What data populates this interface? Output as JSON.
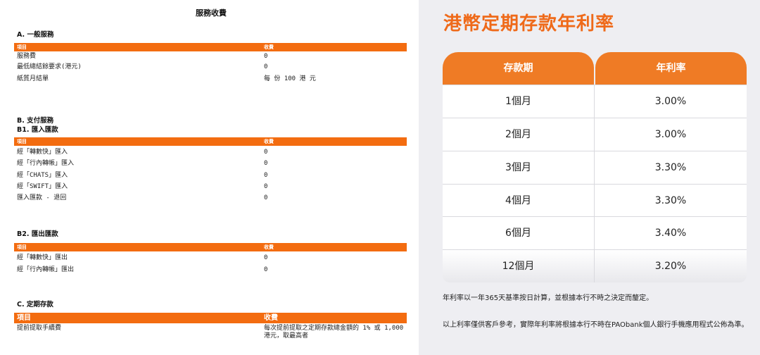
{
  "fees": {
    "title": "服務收費",
    "col_item": "項目",
    "col_fee": "收費",
    "sectionA": {
      "heading": "A. 一般服務",
      "rows": [
        {
          "item": "服務費",
          "fee": "0"
        },
        {
          "item": "最低總結餘要求(港元)",
          "fee": "0"
        },
        {
          "item": "紙質月結單",
          "fee": "每 份 100 港 元"
        }
      ]
    },
    "sectionB": {
      "heading": "B. 支付服務",
      "b1_heading": "B1. 匯入匯款",
      "b1_rows": [
        {
          "item": "經「轉數快」匯入",
          "fee": "0"
        },
        {
          "item": "經「行內轉帳」匯入",
          "fee": "0"
        },
        {
          "item": "經「CHATS」匯入",
          "fee": "0"
        },
        {
          "item": "經「SWIFT」匯入",
          "fee": "0"
        },
        {
          "item": "匯入匯款 - 退回",
          "fee": "0"
        }
      ],
      "b2_heading": "B2. 匯出匯款",
      "b2_rows": [
        {
          "item": "經「轉數快」匯出",
          "fee": "0"
        },
        {
          "item": "經「行內轉帳」匯出",
          "fee": "0"
        }
      ]
    },
    "sectionC": {
      "heading": "C. 定期存款",
      "rows": [
        {
          "item": "提前提取手續費",
          "fee": "每次提前提取之定期存款總金額的 1% 或 1,000 港元，取最高者"
        }
      ]
    }
  },
  "rates": {
    "title": "港幣定期存款年利率",
    "col_term": "存款期",
    "col_rate": "年利率",
    "rows": [
      {
        "term": "1個月",
        "rate": "3.00%"
      },
      {
        "term": "2個月",
        "rate": "3.00%"
      },
      {
        "term": "3個月",
        "rate": "3.30%"
      },
      {
        "term": "4個月",
        "rate": "3.30%"
      },
      {
        "term": "6個月",
        "rate": "3.40%"
      },
      {
        "term": "12個月",
        "rate": "3.20%"
      }
    ],
    "note1": "年利率以一年365天基準按日計算，並根據本行不時之決定而釐定。",
    "note2": "以上利率僅供客戶參考，實際年利率將根據本行不時在PAObank個人銀行手機應用程式公佈為準。"
  },
  "colors": {
    "accent_orange": "#f36c10",
    "title_orange": "#ef6a1a",
    "panel_bg": "#eeeef2"
  }
}
